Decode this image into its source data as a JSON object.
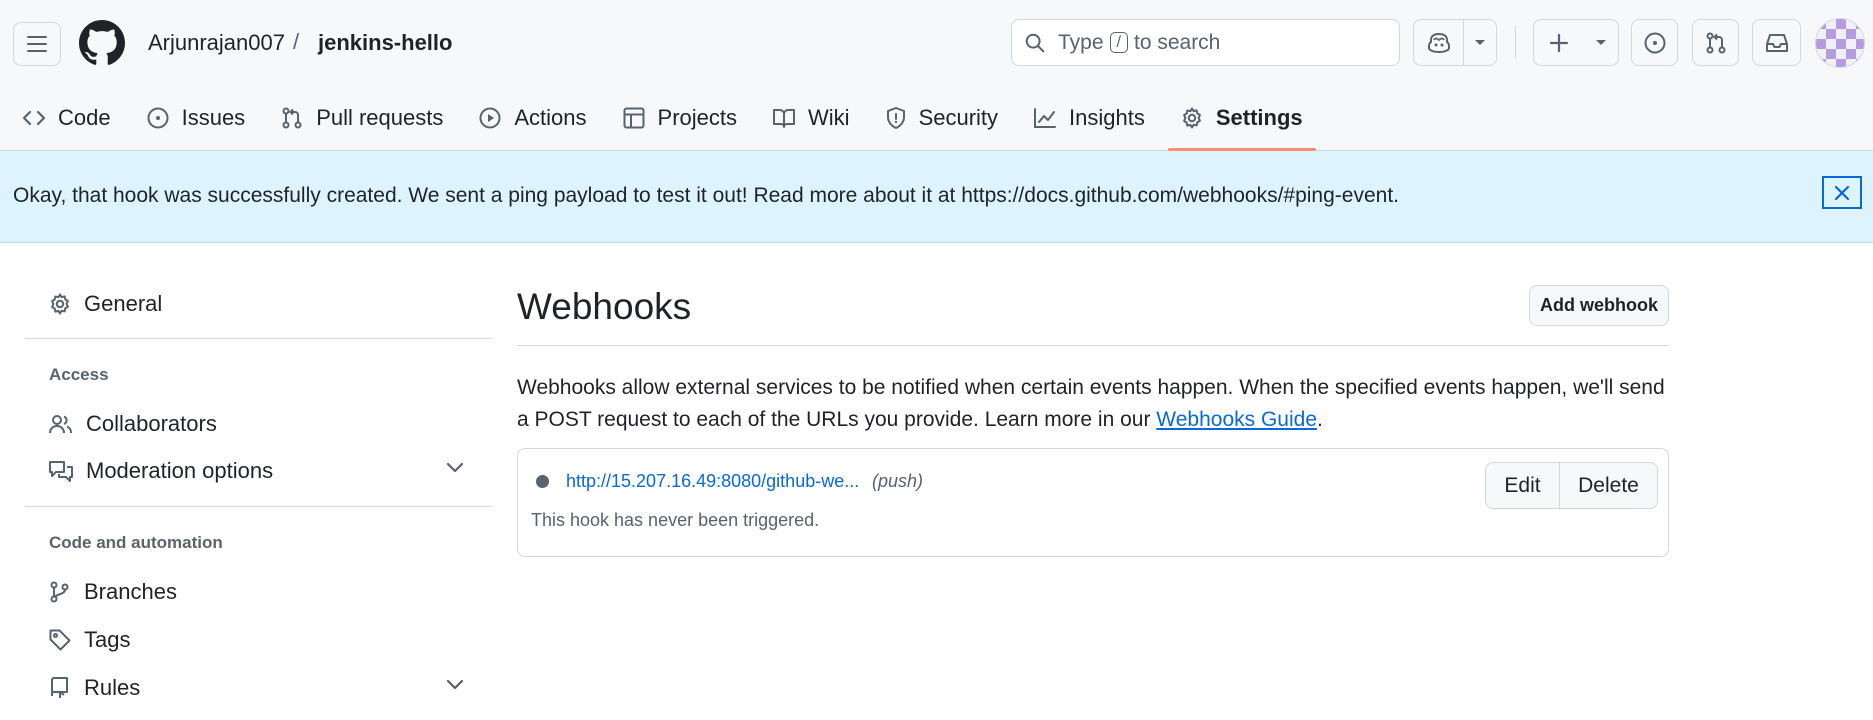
{
  "header": {
    "owner": "Arjunrajan007",
    "separator": "/",
    "repo": "jenkins-hello",
    "search": {
      "prefix": "Type",
      "key": "/",
      "suffix": "to search"
    },
    "icons": [
      "hamburger-icon",
      "github-logo-icon",
      "search-icon",
      "copilot-icon",
      "triangle-down-icon",
      "plus-icon",
      "issue-opened-icon",
      "git-pull-request-icon",
      "inbox-icon",
      "avatar"
    ]
  },
  "tabs": [
    {
      "label": "Code",
      "icon": "code-icon"
    },
    {
      "label": "Issues",
      "icon": "issue-opened-icon"
    },
    {
      "label": "Pull requests",
      "icon": "git-pull-request-icon"
    },
    {
      "label": "Actions",
      "icon": "play-icon"
    },
    {
      "label": "Projects",
      "icon": "table-icon"
    },
    {
      "label": "Wiki",
      "icon": "book-icon"
    },
    {
      "label": "Security",
      "icon": "shield-icon"
    },
    {
      "label": "Insights",
      "icon": "graph-icon"
    },
    {
      "label": "Settings",
      "icon": "gear-icon",
      "active": true
    }
  ],
  "flash": {
    "message": "Okay, that hook was successfully created. We sent a ping payload to test it out! Read more about it at https://docs.github.com/webhooks/#ping-event.",
    "close_icon": "x-icon"
  },
  "sidebar": {
    "general": "General",
    "access_heading": "Access",
    "collaborators": "Collaborators",
    "moderation": "Moderation options",
    "code_heading": "Code and automation",
    "branches": "Branches",
    "tags": "Tags",
    "rules": "Rules"
  },
  "main": {
    "title": "Webhooks",
    "add_button": "Add webhook",
    "description": "Webhooks allow external services to be notified when certain events happen. When the specified events happen, we'll send a POST request to each of the URLs you provide. Learn more in our ",
    "guide_link": "Webhooks Guide",
    "period": ".",
    "hook": {
      "url": "http://15.207.16.49:8080/github-we...",
      "event": "(push)",
      "status": "This hook has never been triggered.",
      "edit": "Edit",
      "delete": "Delete"
    }
  },
  "colors": {
    "accent": "#0969da",
    "active_tab_underline": "#fd8c73",
    "flash_bg": "#ddf4ff",
    "header_bg": "#f6f8fa",
    "border": "#d1d9e0"
  }
}
